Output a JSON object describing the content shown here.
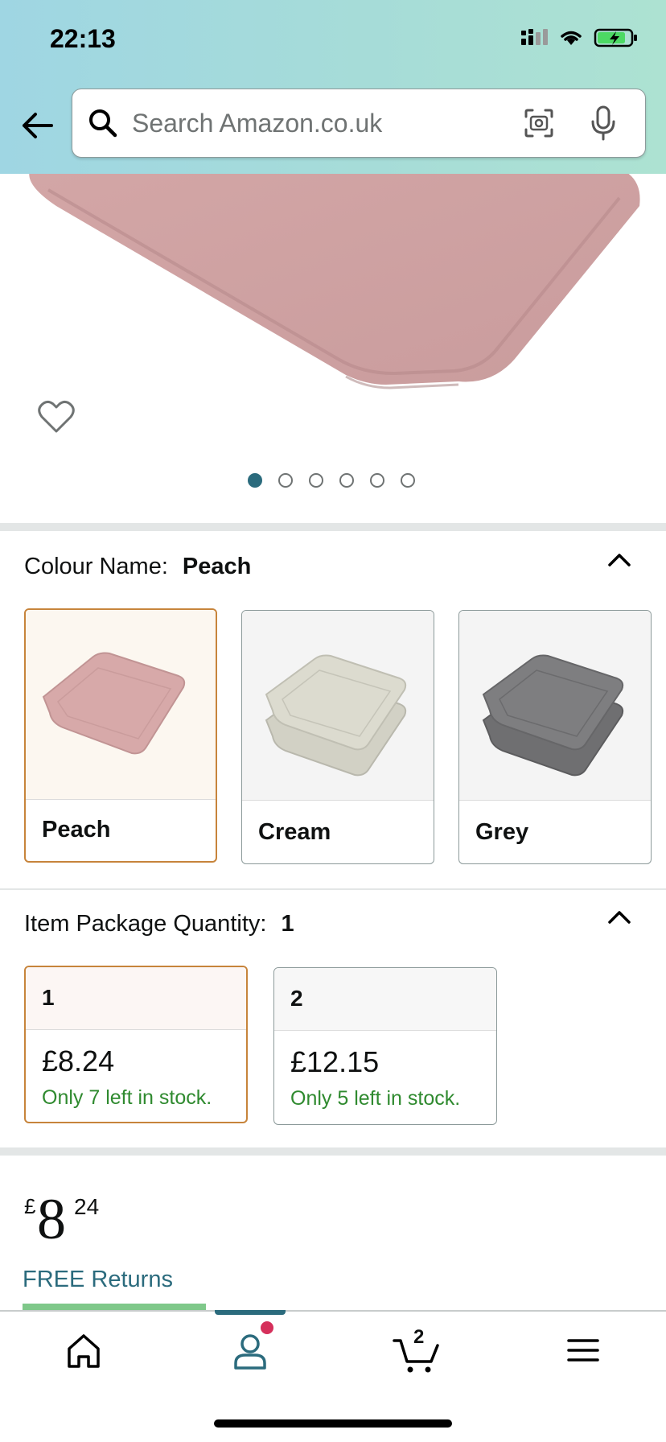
{
  "status_bar": {
    "time": "22:13"
  },
  "search": {
    "placeholder": "Search Amazon.co.uk"
  },
  "gallery": {
    "image_count": 6,
    "active_index": 0
  },
  "colour": {
    "label": "Colour Name:",
    "selected": "Peach",
    "options": [
      {
        "name": "Peach",
        "color": "#d7a9a9"
      },
      {
        "name": "Cream",
        "color": "#dcdbcf"
      },
      {
        "name": "Grey",
        "color": "#7e7e80"
      }
    ]
  },
  "quantity": {
    "label": "Item Package Quantity:",
    "selected": "1",
    "options": [
      {
        "qty": "1",
        "price": "£8.24",
        "stock": "Only 7 left in stock."
      },
      {
        "qty": "2",
        "price": "£12.15",
        "stock": "Only 5 left in stock."
      }
    ]
  },
  "price": {
    "symbol": "£",
    "whole": "8",
    "fraction": "24"
  },
  "returns": {
    "label": "FREE Returns"
  },
  "bottom_nav": {
    "cart_count": "2"
  },
  "colors": {
    "accent": "#2b6b7d",
    "selected_border": "#c7843b",
    "stock_green": "#2f8a2f",
    "badge": "#d5305b"
  }
}
